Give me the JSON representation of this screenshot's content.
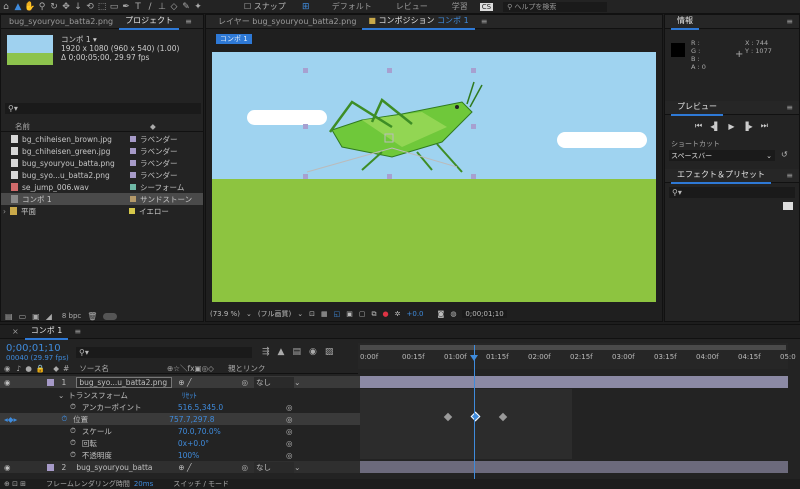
{
  "tabs_top": {
    "active_file": "bug_syouryou_batta2.png",
    "workspaces": [
      "デフォルト",
      "レビュー",
      "学習"
    ],
    "search_placeholder": "ヘルプを検索"
  },
  "project": {
    "tab": "プロジェクト",
    "selected_name": "コンポ 1 ▾",
    "size": "1920 x 1080 (960 x 540) (1.00)",
    "duration": "Δ 0;00;05;00, 29.97 fps",
    "col_name": "名前",
    "items": [
      {
        "name": "bg_chiheisen_brown.jpg",
        "label": "ラベンダー",
        "color": "#a69ac8"
      },
      {
        "name": "bg_chiheisen_green.jpg",
        "label": "ラベンダー",
        "color": "#a69ac8"
      },
      {
        "name": "bug_syouryou_batta.png",
        "label": "ラベンダー",
        "color": "#a69ac8"
      },
      {
        "name": "bug_syo...u_batta2.png",
        "label": "ラベンダー",
        "color": "#a69ac8"
      },
      {
        "name": "se_jump_006.wav",
        "label": "シーフォーム",
        "color": "#6fb8a6"
      },
      {
        "name": "コンポ 1",
        "label": "サンドストーン",
        "color": "#b59a6a"
      },
      {
        "name": "平面",
        "label": "イエロー",
        "color": "#d6c84a"
      }
    ],
    "bpc": "8 bpc"
  },
  "viewer": {
    "layer_tab": "レイヤー bug_syouryou_batta2.png",
    "comp_tab": "コンポジション",
    "comp_name": "コンポ 1",
    "breadcrumb": "コンポ 1",
    "zoom": "(73.9 %)",
    "quality": "(フル画質)",
    "exposure": "+0.0",
    "timecode": "0;00;01;10"
  },
  "info": {
    "tab": "情報",
    "r": "R :",
    "g": "G :",
    "b": "B :",
    "a": "A : 0",
    "x": "X : 744",
    "y": "Y : 1077"
  },
  "preview": {
    "tab": "プレビュー",
    "shortcut_label": "ショートカット",
    "shortcut_value": "スペースバー"
  },
  "effects": {
    "tab": "エフェクト＆プリセット"
  },
  "timeline": {
    "tab": "コンポ 1",
    "timecode": "0;00;01;10",
    "frames": "00040 (29.97 fps)",
    "col_source": "ソース名",
    "col_parent": "親とリンク",
    "ruler": [
      "0:00f",
      "00:15f",
      "01:00f",
      "01:15f",
      "02:00f",
      "02:15f",
      "03:00f",
      "03:15f",
      "04:00f",
      "04:15f",
      "05:0"
    ],
    "layer1": {
      "num": "1",
      "name": "bug_syo...u_batta2.png",
      "parent": "なし"
    },
    "transform": "トランスフォーム",
    "reset": "ﾘｾｯﾄ",
    "props": [
      {
        "name": "アンカーポイント",
        "value": "516.5,345.0"
      },
      {
        "name": "位置",
        "value": "757.7,297.8"
      },
      {
        "name": "スケール",
        "value": "70.0,70.0%"
      },
      {
        "name": "回転",
        "value": "0x+0.0°"
      },
      {
        "name": "不透明度",
        "value": "100%"
      }
    ],
    "layer2": {
      "num": "2",
      "name": "bug_syouryou_batta",
      "parent": "なし"
    },
    "footer_render": "フレームレンダリング時間",
    "footer_ms": "20ms",
    "footer_switch": "スイッチ / モード"
  }
}
